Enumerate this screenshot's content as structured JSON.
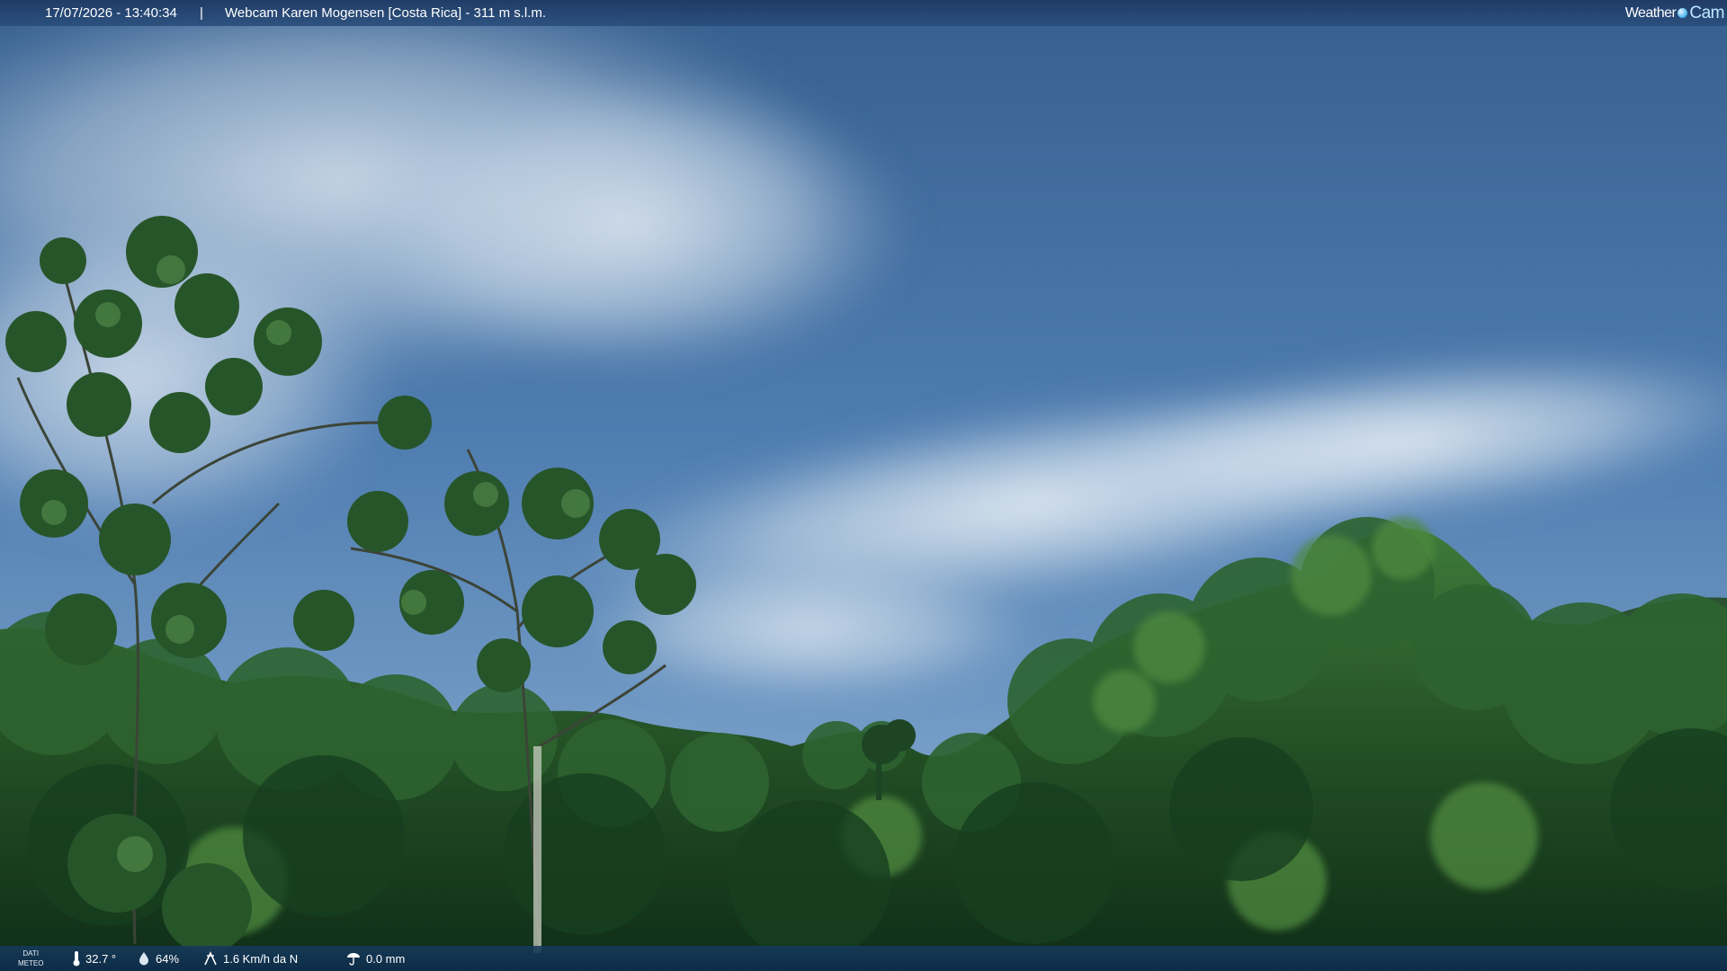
{
  "overlay_top": {
    "timestamp": "17/07/2026 - 13:40:34",
    "separator": "|",
    "title": "Webcam Karen Mogensen [Costa Rica] - 311 m s.l.m.",
    "brand_weather": "Weather",
    "brand_cam": "Cam"
  },
  "overlay_bottom": {
    "meteo_label_line1": "DATI",
    "meteo_label_line2": "METEO",
    "temperature": "32.7 °",
    "humidity": "64%",
    "wind": "1.6 Km/h da N",
    "rain": "0.0 mm"
  },
  "icons": {
    "temperature": "thermometer-icon",
    "humidity": "water-drop-icon",
    "wind": "wind-icon",
    "rain": "rain-gauge-icon"
  },
  "colors": {
    "sky_top": "#37608f",
    "sky_bottom": "#6f99c5",
    "cloud": "#dfe8f1",
    "foliage_dark": "#12351b",
    "foliage_mid": "#2f6a32",
    "foliage_light": "#5f9a4a",
    "overlay_bar": "#1c3d62"
  }
}
